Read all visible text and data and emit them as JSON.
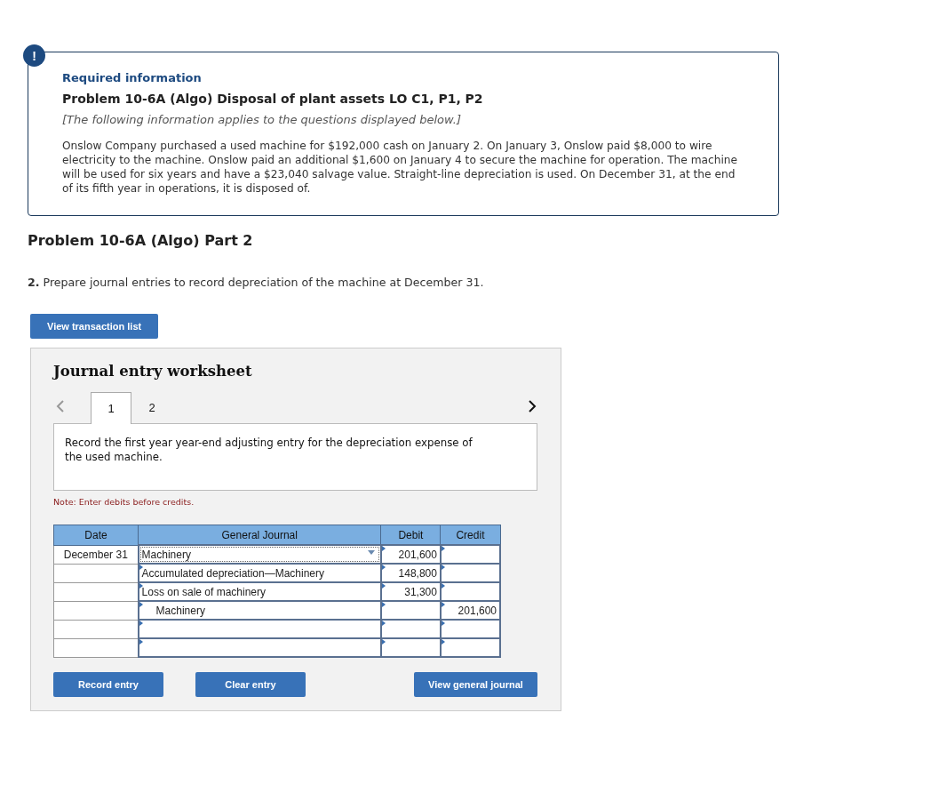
{
  "info": {
    "alert": "!",
    "heading": "Required information",
    "title": "Problem 10-6A (Algo) Disposal of plant assets LO C1, P1, P2",
    "note": "[The following information applies to the questions displayed below.]",
    "body": "Onslow Company purchased a used machine for $192,000 cash on January 2. On January 3, Onslow paid $8,000 to wire electricity to the machine. Onslow paid an additional $1,600 on January 4 to secure the machine for operation. The machine will be used for six years and have a $23,040 salvage value. Straight-line depreciation is used. On December 31, at the end of its fifth year in operations, it is disposed of."
  },
  "part_title": "Problem 10-6A (Algo) Part 2",
  "question": {
    "number": "2.",
    "text": "Prepare journal entries to record depreciation of the machine at December 31."
  },
  "transaction_button": "View transaction list",
  "worksheet": {
    "title": "Journal entry worksheet",
    "tabs": [
      {
        "label": "1",
        "selected": true
      },
      {
        "label": "2",
        "selected": false
      }
    ],
    "prompt": "Record the first year year-end adjusting entry for the depreciation expense of the used machine.",
    "note": "Note: Enter debits before credits.",
    "columns": [
      "Date",
      "General Journal",
      "Debit",
      "Credit"
    ],
    "rows": [
      {
        "date": "December 31",
        "account": "Machinery",
        "debit": "201,600",
        "selected": true,
        "indented": false
      },
      {
        "account": "Accumulated depreciation—Machinery",
        "debit": "148,800",
        "selected": false,
        "indented": false
      },
      {
        "account": "Loss on sale of machinery",
        "debit": "31,300",
        "selected": false,
        "indented": false
      },
      {
        "account": "Machinery",
        "credit": "201,600",
        "selected": false,
        "indented": true
      },
      {
        "selected": false
      },
      {
        "selected": false
      }
    ],
    "buttons": [
      "Record entry",
      "Clear entry",
      "View general journal"
    ]
  }
}
